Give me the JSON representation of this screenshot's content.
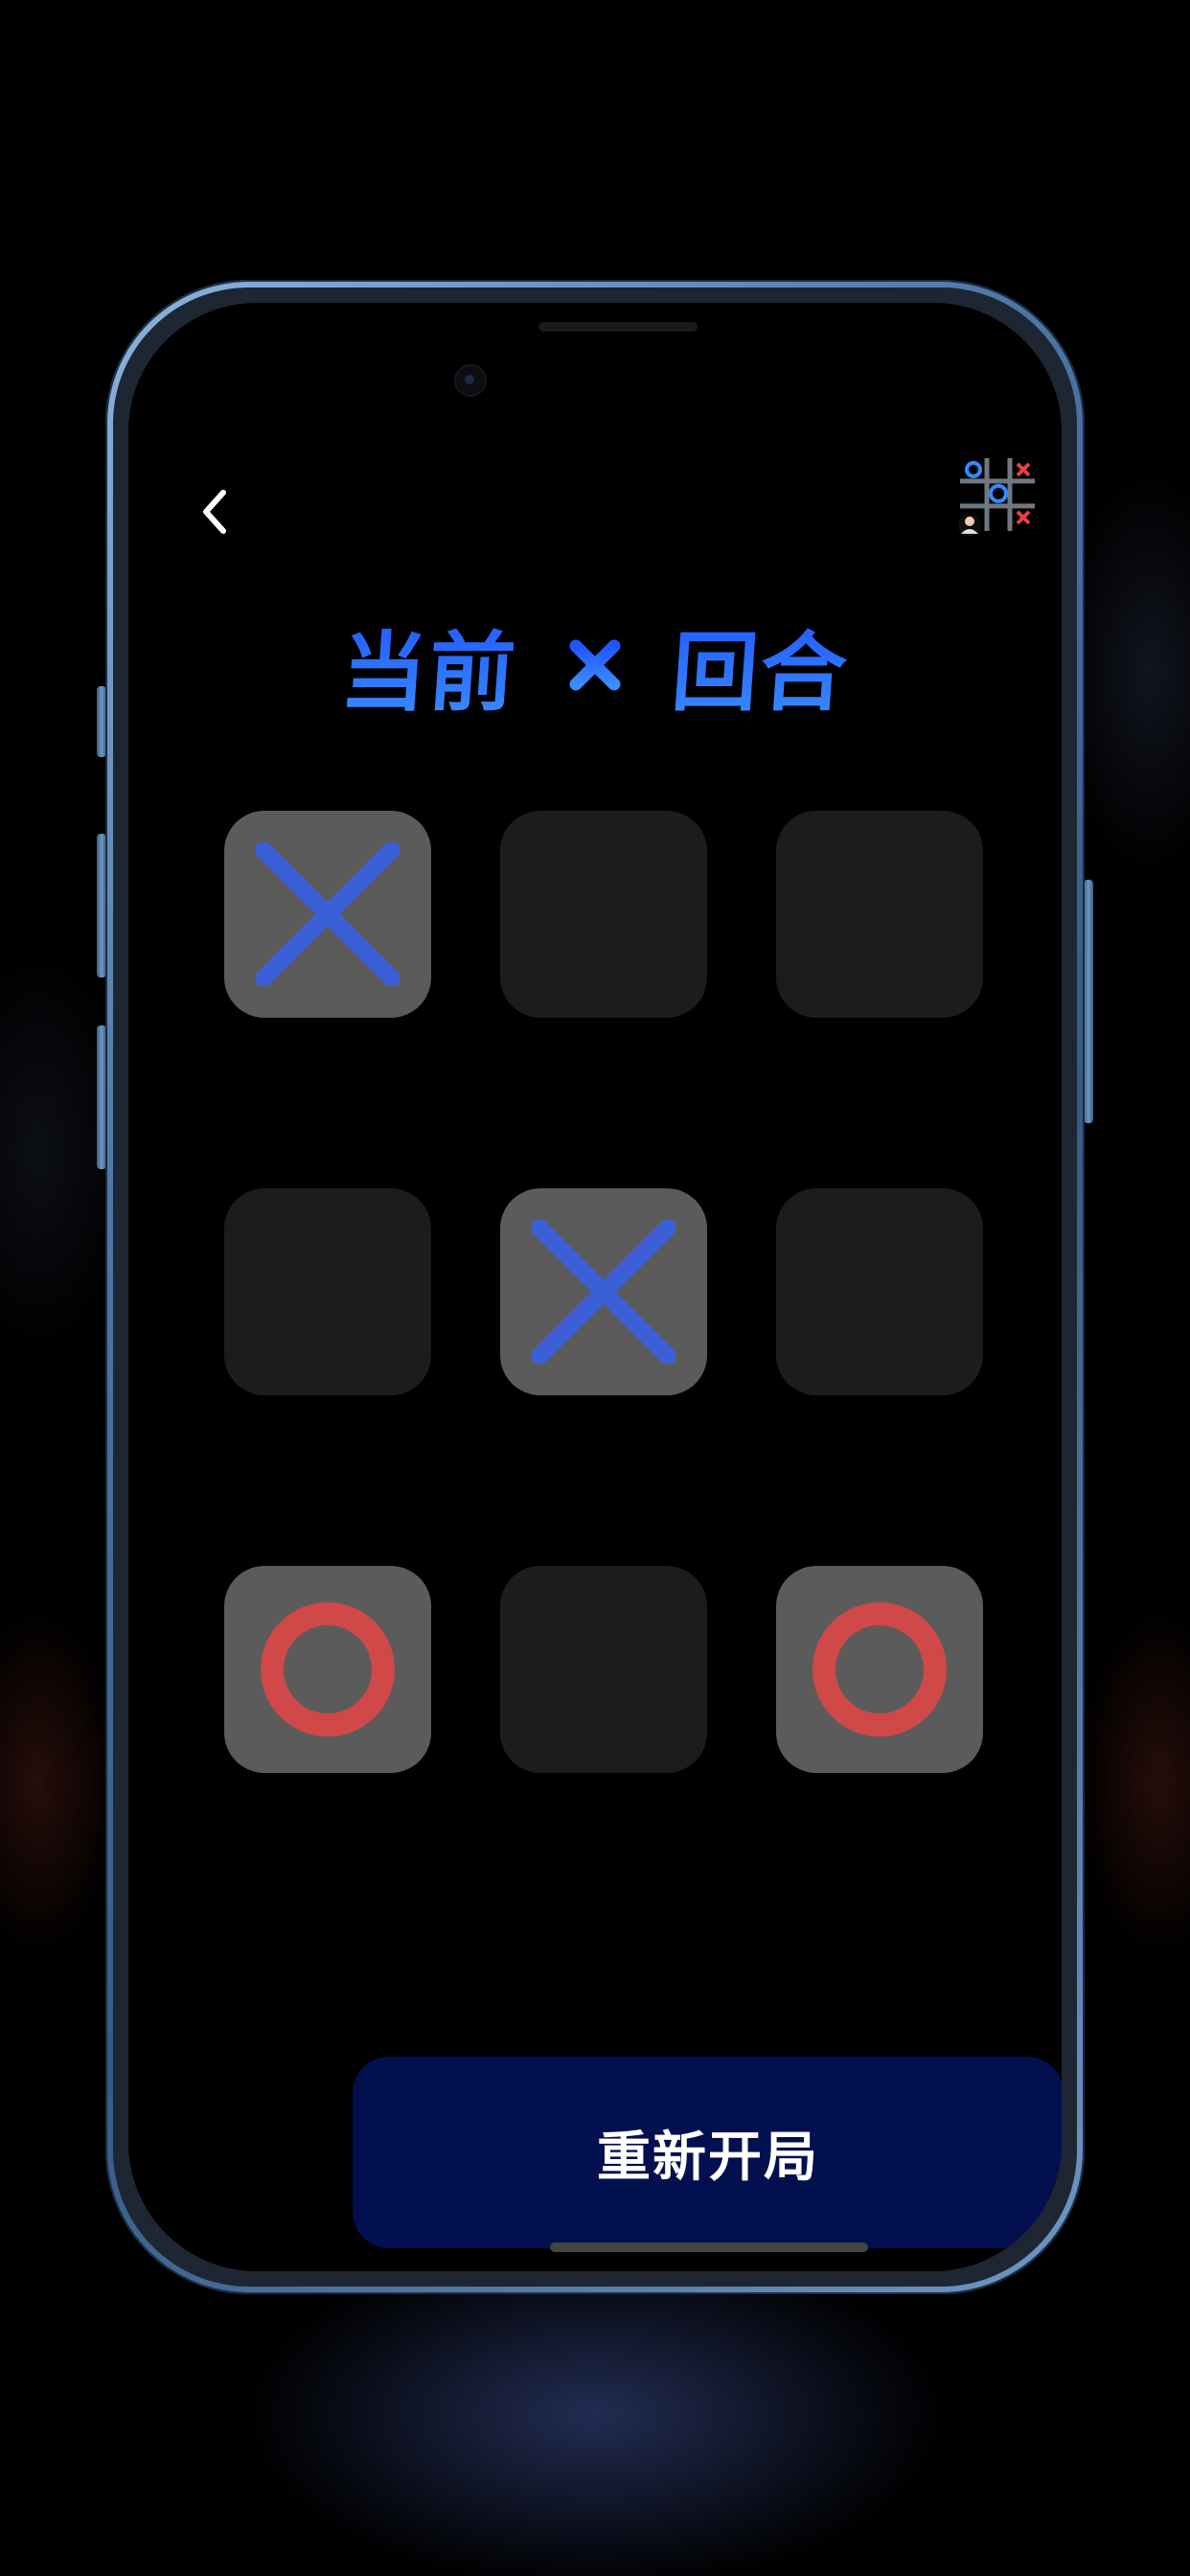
{
  "header": {
    "back_icon": "chevron-left-icon",
    "logo_icon": "tic-tac-toe-logo-icon"
  },
  "turn": {
    "prefix": "当前",
    "current_player": "X",
    "suffix": "回合"
  },
  "board": {
    "cells": [
      "X",
      "",
      "",
      "",
      "X",
      "",
      "O",
      "",
      "O"
    ]
  },
  "colors": {
    "x_mark": "#3b5fd6",
    "o_mark": "#d04848",
    "empty_cell": "#1c1c1c",
    "filled_cell": "#5b5b5b",
    "title_gradient_top": "#1f55ff",
    "title_gradient_bottom": "#3a8dff",
    "restart_button": "#03104f"
  },
  "restart": {
    "label": "重新开局"
  }
}
